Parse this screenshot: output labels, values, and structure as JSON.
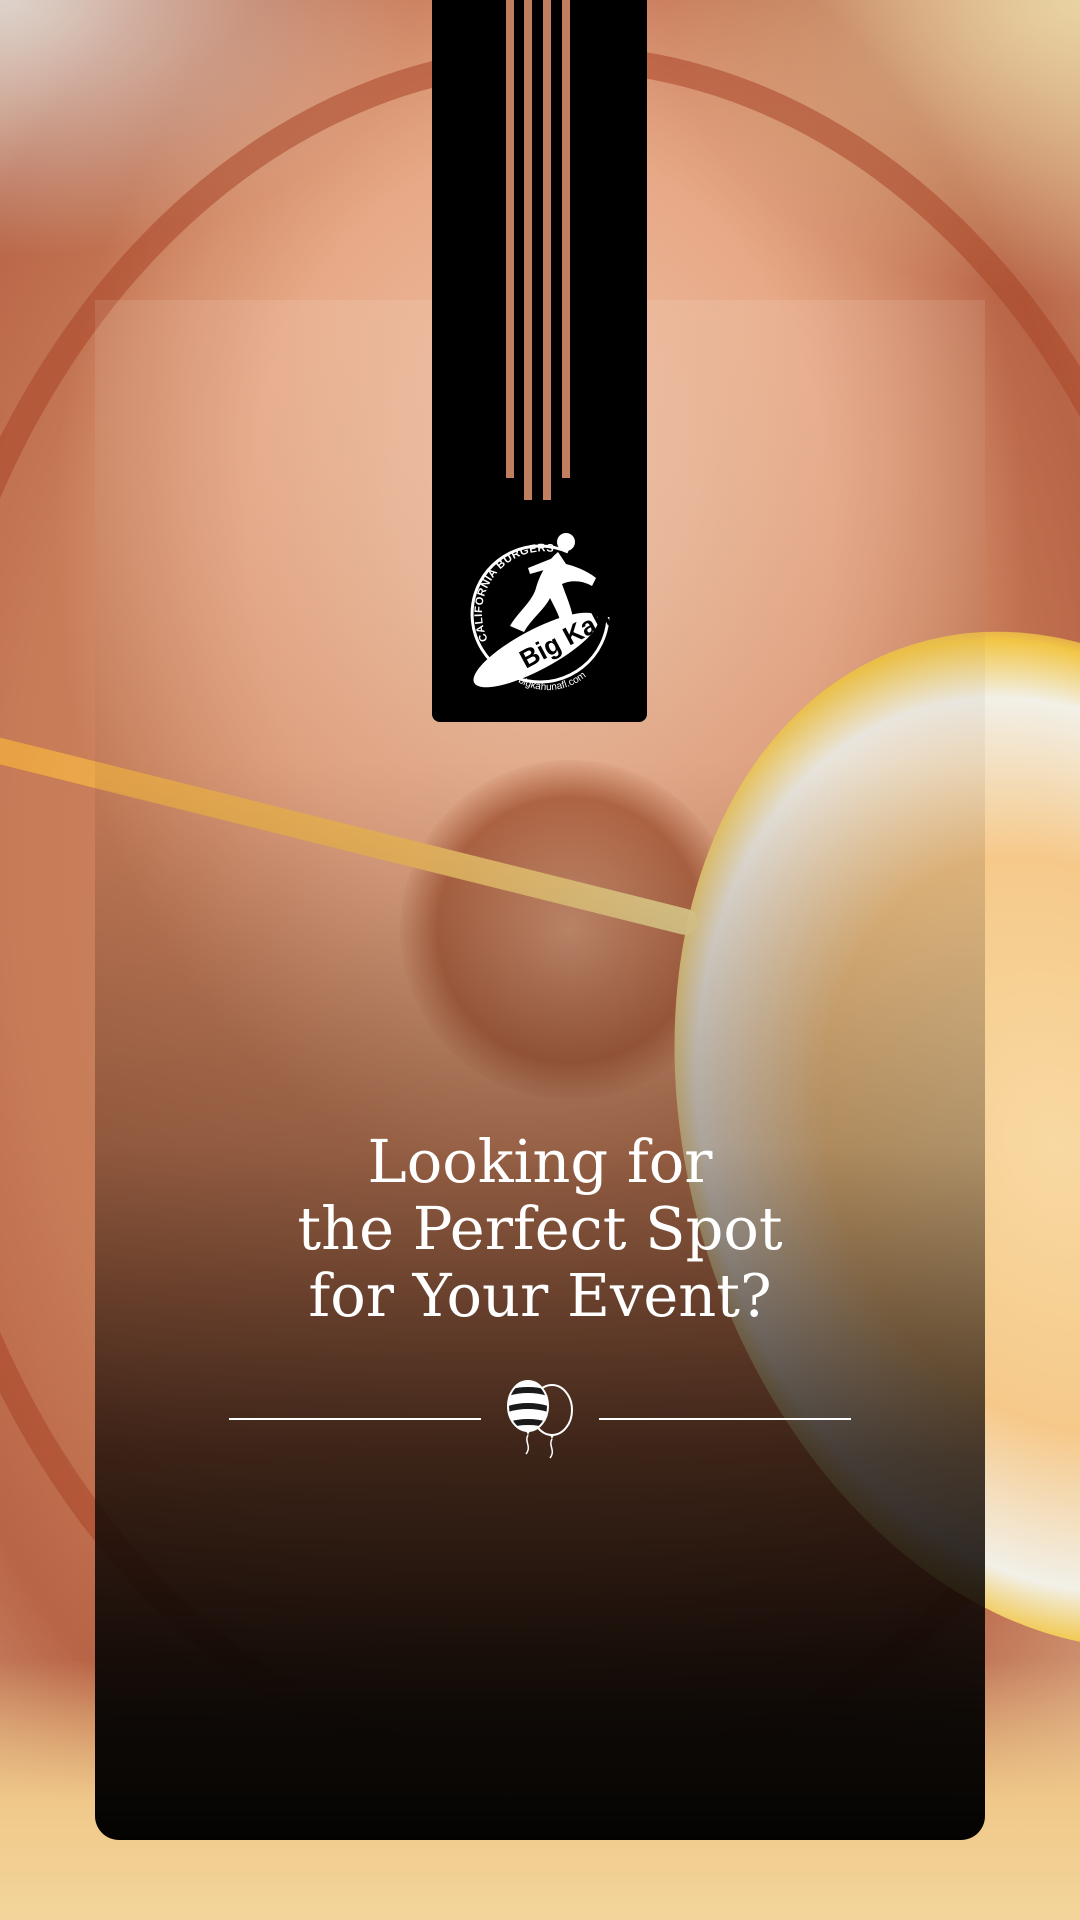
{
  "brand": {
    "tagline": "CALIFORNIA BURGERS & TACOS",
    "name": "Big Kahuna",
    "website": "bigkahunafl.com"
  },
  "headline": {
    "line1": "Looking for",
    "line2": "the Perfect Spot",
    "line3": "for Your Event?"
  },
  "icons": {
    "divider": "balloons-icon",
    "logo": "surfer-icon"
  },
  "colors": {
    "banner": "#000000",
    "stripes": "#c08060",
    "text": "#ffffff"
  }
}
